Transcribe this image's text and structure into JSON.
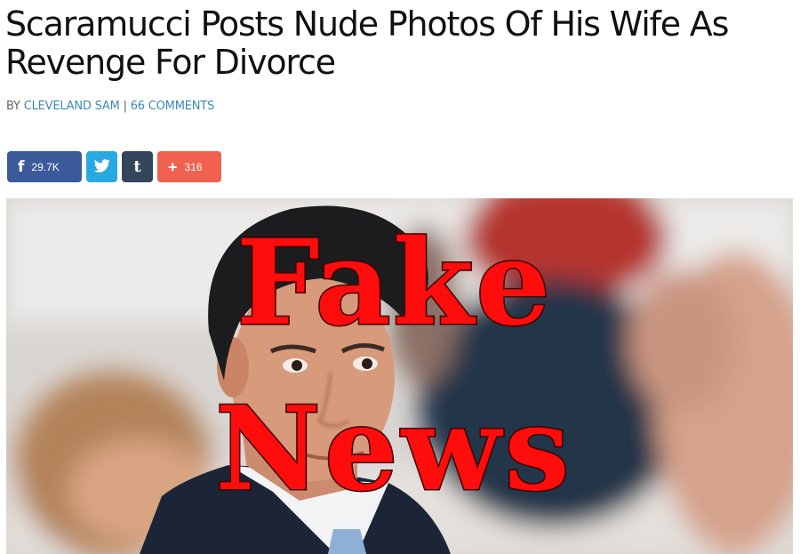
{
  "article": {
    "headline": "Scaramucci Posts Nude Photos Of His Wife As Revenge For Divorce",
    "byline": {
      "prefix": "BY",
      "author": "CLEVELAND SAM",
      "separator": "|",
      "comments": "66 COMMENTS"
    }
  },
  "share": {
    "facebook": {
      "icon": "facebook-icon",
      "count": "29.7K",
      "color": "#3b5a9a"
    },
    "twitter": {
      "icon": "twitter-icon",
      "color": "#29a9e1"
    },
    "tumblr": {
      "icon": "tumblr-icon",
      "glyph": "t",
      "color": "#35465c"
    },
    "more": {
      "icon": "plus-icon",
      "count": "316",
      "color": "#f0624f"
    }
  },
  "hero": {
    "overlay_line1": "Fake",
    "overlay_line2": "News",
    "overlay_color": "#ff0d0d"
  },
  "colors": {
    "link": "#3a8ab6",
    "headline": "#111111"
  }
}
